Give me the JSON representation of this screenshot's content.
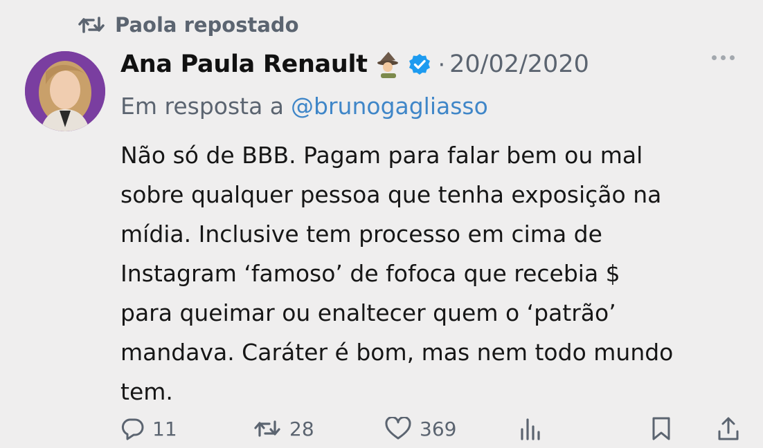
{
  "repost": {
    "icon": "repost-icon",
    "text": "Paola repostado"
  },
  "tweet": {
    "author": {
      "display_name": "Ana Paula Renault",
      "emoji": "mage-emoji",
      "verified": true,
      "avatar": "avatar-photo"
    },
    "separator": "·",
    "date": "20/02/2020",
    "reply_prefix": "Em resposta a",
    "reply_handle": "@brunogagliasso",
    "text_lines": [
      "Não só de BBB. Pagam para falar bem ou mal",
      "sobre qualquer pessoa que tenha exposição na",
      "mídia. Inclusive tem processo em cima de",
      "Instagram ‘famoso’ de fofoca que recebia $",
      "para queimar ou enaltecer quem o ‘patrão’",
      "mandava. Caráter é bom, mas nem todo mundo",
      "tem."
    ]
  },
  "actions": {
    "replies": "11",
    "reposts": "28",
    "likes": "369"
  },
  "colors": {
    "background": "#efeeee",
    "muted": "#5b6470",
    "link": "#3f86c8",
    "verified": "#1d9bf0",
    "avatar_bg": "#7a3ea0"
  }
}
